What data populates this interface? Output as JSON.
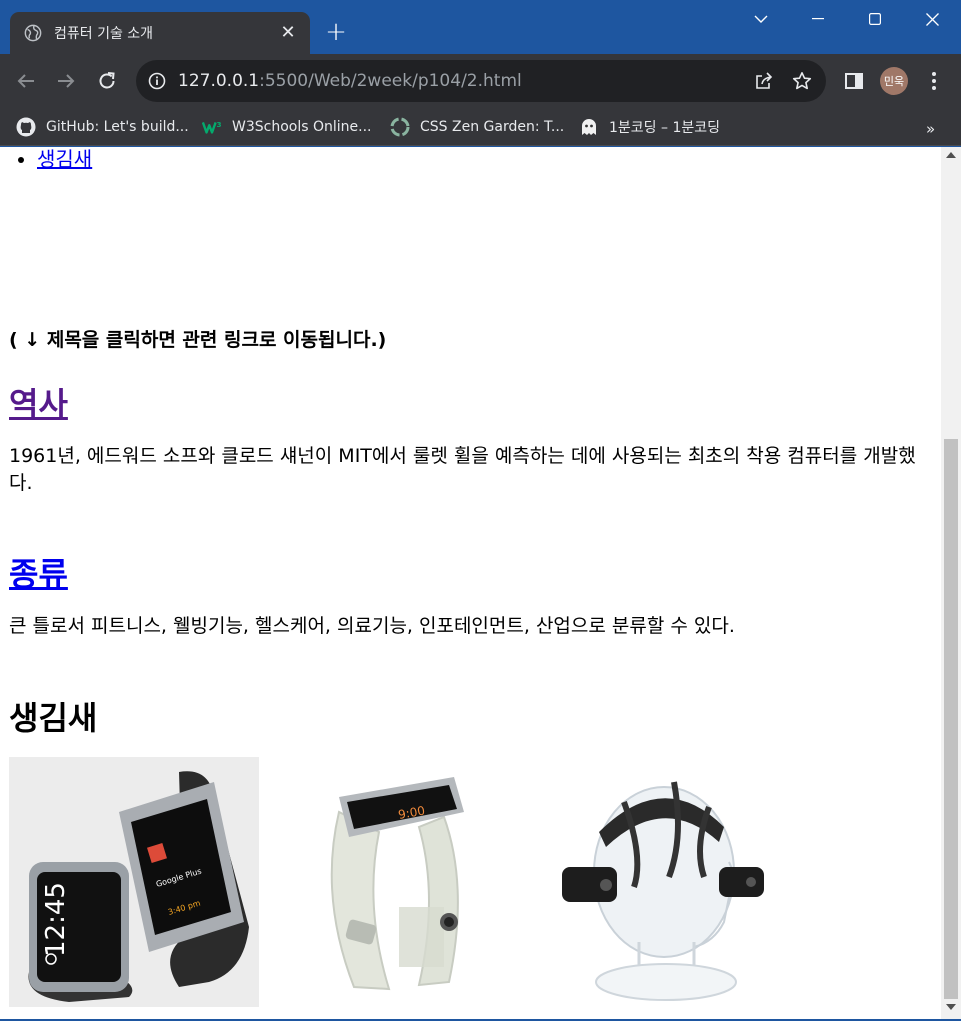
{
  "browser": {
    "tab_title": "컴퓨터 기술 소개",
    "tab_close": "✕",
    "new_tab": "+",
    "url_host": "127.0.0.1",
    "url_path": ":5500/Web/2week/p104/2.html",
    "profile": "민욱",
    "bookmarks": [
      {
        "label": "GitHub: Let's build...",
        "icon": "github-icon"
      },
      {
        "label": "W3Schools Online...",
        "icon": "w3schools-icon"
      },
      {
        "label": "CSS Zen Garden: T...",
        "icon": "zen-garden-icon"
      },
      {
        "label": "1분코딩 – 1분코딩",
        "icon": "ghost-icon"
      }
    ],
    "bookmarks_more": "»"
  },
  "page": {
    "nav_items": [
      "생김새"
    ],
    "hint": "( ↓ 제목을 클릭하면 관련 링크로 이동됩니다.)",
    "sections": [
      {
        "title": "역사",
        "text": "1961년, 에드워드 소프와 클로드 섀넌이 MIT에서 룰렛 휠을 예측하는 데에 사용되는 최초의 착용 컴퓨터를 개발했다."
      },
      {
        "title": "종류",
        "text": "큰 틀로서 피트니스, 웰빙기능, 헬스케어, 의료기능, 인포테인먼트, 산업으로 분류할 수 있다."
      }
    ],
    "look_heading": "생김새",
    "images": [
      {
        "icon": "smartwatch-pair-image",
        "watch_time": "12:45",
        "watch_label": "Google Plus",
        "watch_sub": "3:40 pm"
      },
      {
        "icon": "galaxy-gear-image",
        "watch_time": "9:00"
      },
      {
        "icon": "head-mounted-display-image"
      }
    ]
  },
  "colors": {
    "titlebar": "#1e56a0",
    "toolbar": "#35363a",
    "link": "#0000ee",
    "visited_link": "#551a8b"
  }
}
